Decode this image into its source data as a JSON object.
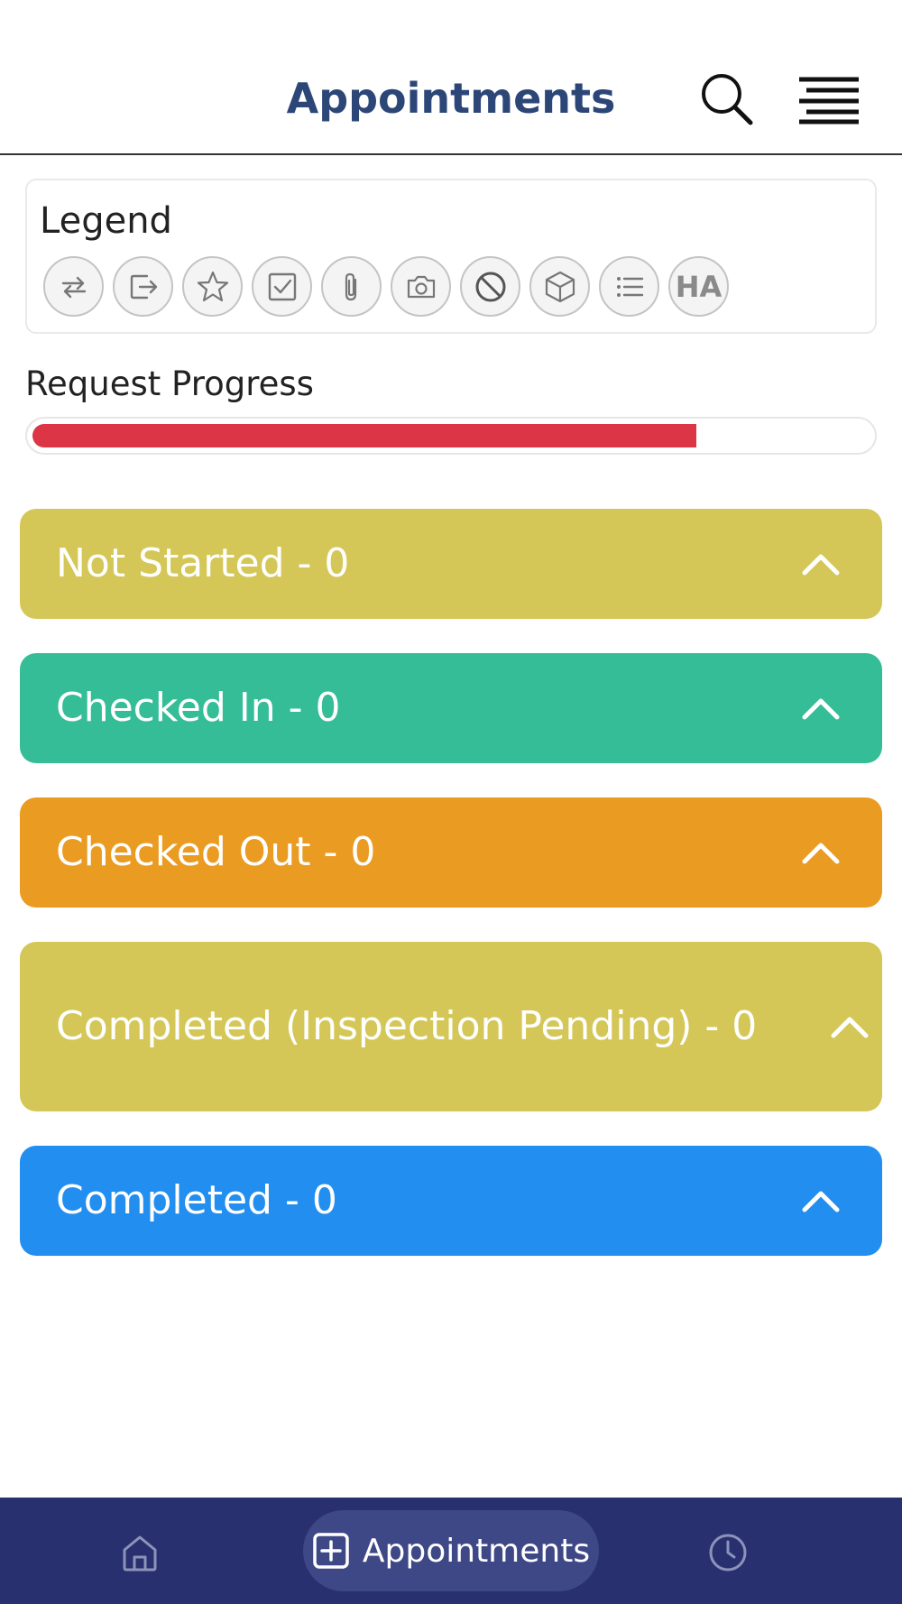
{
  "header": {
    "title": "Appointments",
    "search_icon": "search-icon",
    "menu_icon": "menu-icon"
  },
  "legend": {
    "title": "Legend",
    "icons": [
      "repeat-icon",
      "exit-icon",
      "star-icon",
      "checkbox-icon",
      "paperclip-icon",
      "camera-icon",
      "ban-icon",
      "box-icon",
      "list-icon",
      "ha-badge"
    ],
    "ha_text": "HA"
  },
  "progress": {
    "label": "Request Progress",
    "value_percent": 79,
    "color": "#dc3545"
  },
  "sections": [
    {
      "label": "Not Started - 0",
      "color": "#d4c757"
    },
    {
      "label": "Checked In - 0",
      "color": "#35bd97"
    },
    {
      "label": "Checked Out - 0",
      "color": "#ea9b21"
    },
    {
      "label": "Completed (Inspection Pending) - 0",
      "color": "#d4c757"
    },
    {
      "label": "Completed - 0",
      "color": "#228ef0"
    }
  ],
  "bottom_nav": {
    "home_icon": "home-icon",
    "active_label": "Appointments",
    "active_icon": "plus-square-icon",
    "history_icon": "clock-icon",
    "background": "#283070"
  }
}
